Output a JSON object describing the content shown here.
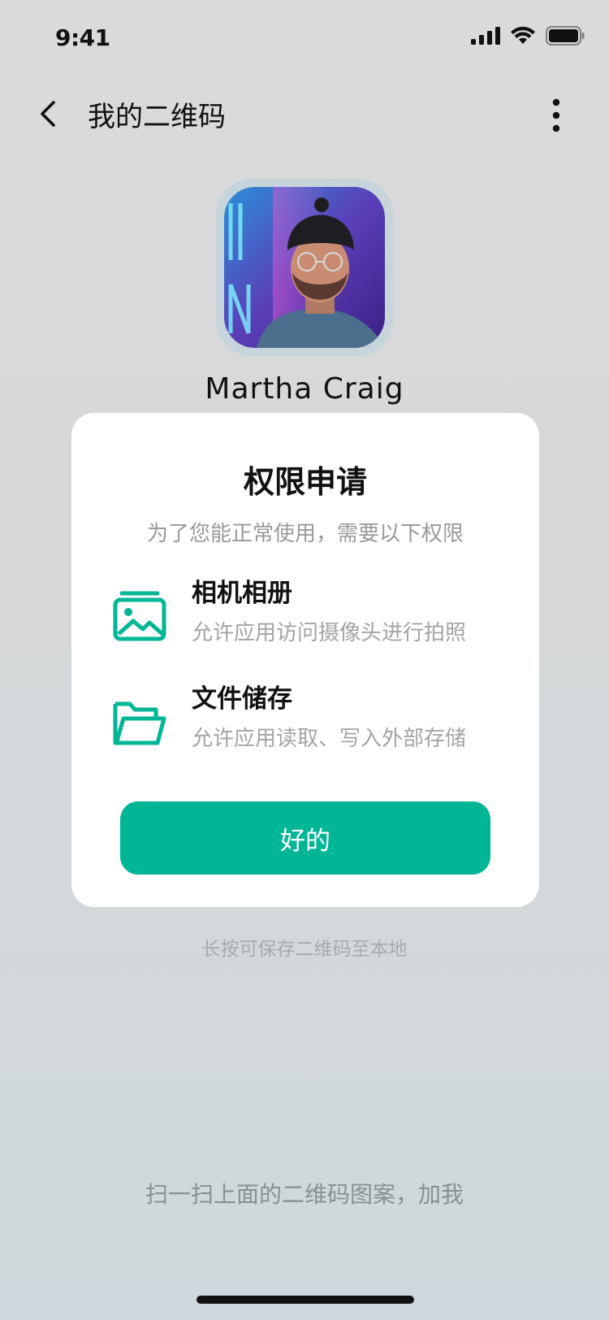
{
  "status_bar": {
    "time": "9:41"
  },
  "nav": {
    "title": "我的二维码"
  },
  "profile": {
    "name": "Martha Craig"
  },
  "dialog": {
    "title": "权限申请",
    "subtitle": "为了您能正常使用，需要以下权限",
    "permissions": [
      {
        "icon": "image-icon",
        "name": "相机相册",
        "description": "允许应用访问摄像头进行拍照"
      },
      {
        "icon": "folder-icon",
        "name": "文件储存",
        "description": "允许应用读取、写入外部存储"
      }
    ],
    "confirm_label": "好的"
  },
  "hint": "长按可保存二维码至本地",
  "scan_text": "扫一扫上面的二维码图案，加我",
  "colors": {
    "accent": "#00b695",
    "dialog_bg": "#ffffff"
  }
}
